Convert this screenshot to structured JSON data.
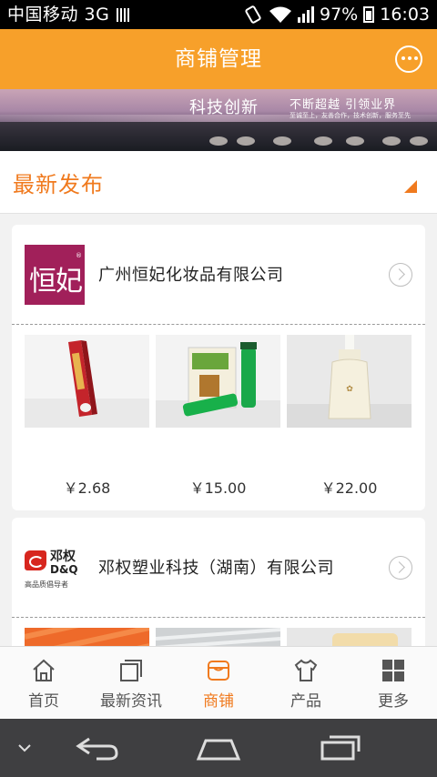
{
  "status_bar": {
    "carrier": "中国移动 3G",
    "battery": "97%",
    "time": "16:03"
  },
  "header": {
    "title": "商铺管理",
    "chat_icon": "chat-bubble-icon"
  },
  "banner": {
    "slogan": "科技创新",
    "slogan2": "不断超越 引领业界",
    "slogan3": "至诚至上，友善合作，技术创新，服务至先"
  },
  "section": {
    "title": "最新发布"
  },
  "cards": [
    {
      "company": "广州恒妃化妆品有限公司",
      "logo_text": "恒妃",
      "prices": [
        "￥2.68",
        "￥15.00",
        "￥22.00"
      ]
    },
    {
      "company": "邓权塑业科技（湖南）有限公司",
      "logo_cn": "邓权",
      "logo_en": "D&Q",
      "logo_tagline": "高品质倡导者"
    }
  ],
  "bottom_nav": {
    "items": [
      {
        "label": "首页",
        "icon": "home-icon"
      },
      {
        "label": "最新资讯",
        "icon": "news-icon"
      },
      {
        "label": "商铺",
        "icon": "shop-icon",
        "active": true
      },
      {
        "label": "产品",
        "icon": "shirt-icon"
      },
      {
        "label": "更多",
        "icon": "grid-icon"
      }
    ]
  },
  "colors": {
    "accent": "#f7a02a",
    "highlight": "#f07a1e"
  }
}
